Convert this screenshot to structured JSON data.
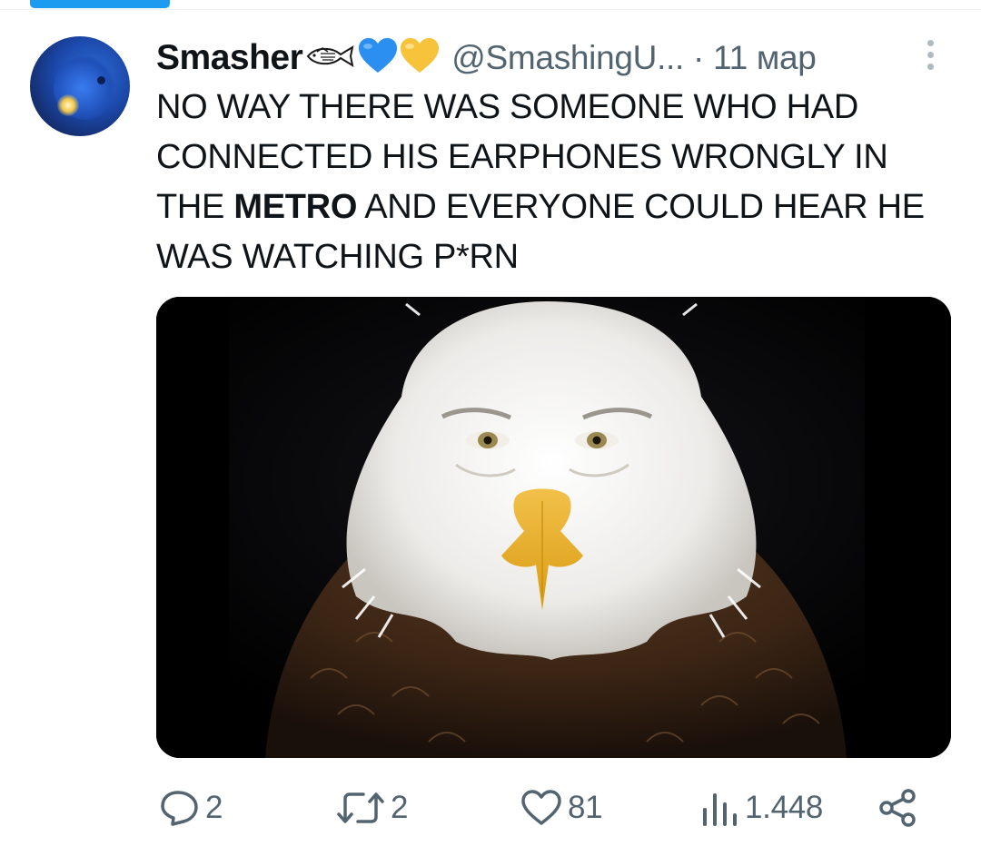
{
  "tweet": {
    "display_name": "Smasher",
    "handle": "@SmashingU...",
    "separator": "·",
    "date": "11 мар",
    "name_emoji": [
      "fish-emoji",
      "blue-heart-emoji",
      "yellow-heart-emoji"
    ],
    "text": {
      "line1": "NO WAY THERE WAS SOMEONE WHO HAD",
      "line2": "CONNECTED HIS EARPHONES WRONGLY IN",
      "line3_pre": "THE ",
      "line3_bold": "METRO",
      "line3_post": " AND EVERYONE COULD HEAR HE",
      "line4": "WAS WATCHING P*RN"
    },
    "media": {
      "subject": "bald eagle with human face"
    }
  },
  "actions": {
    "reply": {
      "icon": "reply-icon",
      "count": "2"
    },
    "retweet": {
      "icon": "retweet-icon",
      "count": "2"
    },
    "like": {
      "icon": "heart-icon",
      "count": "81"
    },
    "views": {
      "icon": "views-icon",
      "count": "1.448"
    },
    "share": {
      "icon": "share-icon"
    }
  },
  "colors": {
    "accent": "#1d9bf0",
    "text_primary": "#0f1419",
    "text_secondary": "#536471",
    "blue_heart": "#2a8ff0",
    "yellow_heart": "#f6c33b"
  }
}
